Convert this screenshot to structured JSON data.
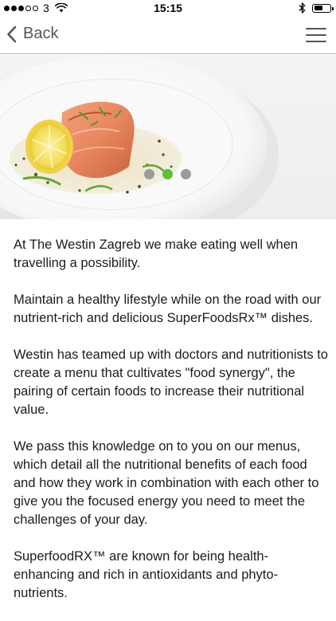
{
  "status_bar": {
    "carrier": "3",
    "time": "15:15",
    "signal_strength": 3,
    "battery_level": 0.6
  },
  "nav": {
    "back_label": "Back"
  },
  "carousel": {
    "page_count": 3,
    "active_index": 1,
    "active_color": "#5fbf3a",
    "inactive_color": "#9b9b9b"
  },
  "content": {
    "paragraphs": [
      "At The Westin Zagreb we make eating well when travelling a possibility.",
      "Maintain a healthy lifestyle while on the road with our nutrient-rich and delicious SuperFoodsRx™ dishes.",
      "Westin has teamed up with doctors and nutritionists to create a menu that cultivates \"food synergy\", the pairing of certain foods to increase their nutritional value.",
      "We pass this knowledge on to you on our menus, which detail all the nutritional benefits of each food and how they work in combination with each other to give you the focused energy you need to meet the challenges of your day.",
      "SuperfoodRX™ are known for being health-enhancing and rich in antioxidants and phyto-nutrients."
    ]
  }
}
